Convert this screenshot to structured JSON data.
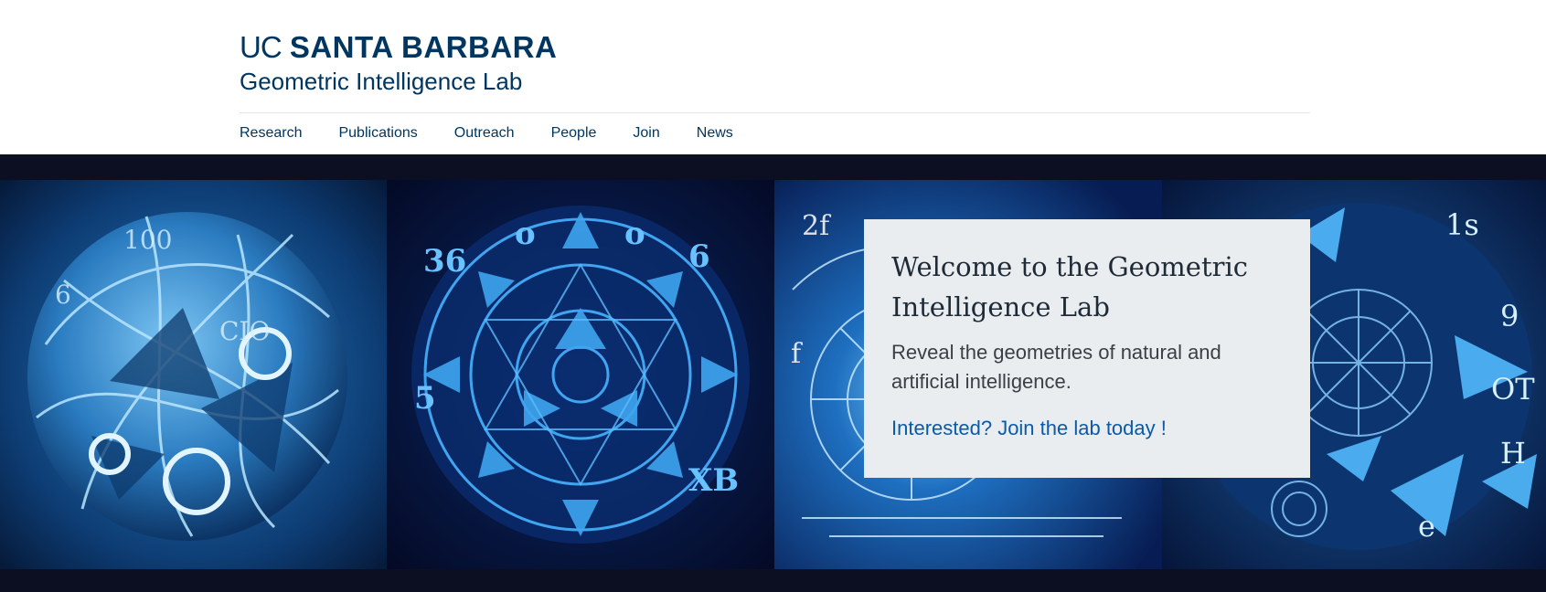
{
  "brand": {
    "uc": "UC",
    "university": "SANTA BARBARA",
    "lab": "Geometric Intelligence Lab"
  },
  "nav": [
    {
      "label": "Research"
    },
    {
      "label": "Publications"
    },
    {
      "label": "Outreach"
    },
    {
      "label": "People"
    },
    {
      "label": "Join"
    },
    {
      "label": "News"
    }
  ],
  "hero": {
    "images": [
      {
        "icon": "abstract-math-sphere-image"
      },
      {
        "icon": "geometric-mandala-image"
      },
      {
        "icon": "glowing-compass-image"
      },
      {
        "icon": "math-symbols-sphere-image"
      }
    ],
    "card": {
      "title": "Welcome to the Geometric Intelligence Lab",
      "text": "Reveal the geometries of natural and artificial intelligence.",
      "link": "Interested? Join the lab today !"
    }
  },
  "colors": {
    "brand_navy": "#003660",
    "hero_background": "#0c0e22",
    "card_background": "#e9edf0",
    "link_blue": "#0b5aa8"
  }
}
